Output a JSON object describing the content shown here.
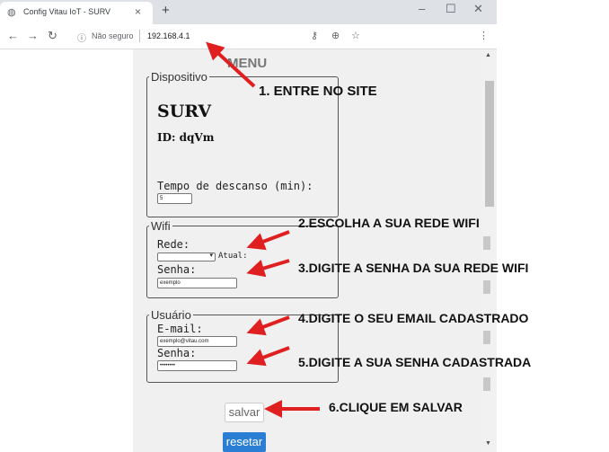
{
  "browser": {
    "tab_title": "Config Vitau IoT - SURV",
    "tab_close": "×",
    "new_tab": "+",
    "security_label": "Não seguro",
    "url": "192.168.4.1"
  },
  "page": {
    "menu_title": "MENU",
    "device": {
      "legend": "Dispositivo",
      "name": "SURV",
      "id": "ID: dqVm",
      "rest_label": "Tempo de descanso (min):",
      "rest_value": "5"
    },
    "wifi": {
      "legend": "Wifi",
      "network_label": "Rede:",
      "current_label": "Atual:",
      "password_label": "Senha:",
      "password_value": "exemplo"
    },
    "user": {
      "legend": "Usuário",
      "email_label": "E-mail:",
      "email_value": "exemplo@vitau.com",
      "password_label": "Senha:",
      "password_value": "••••••••"
    },
    "save_button": "salvar",
    "reset_button": "resetar"
  },
  "annotations": {
    "step1": "1. ENTRE NO SITE",
    "step2": "2.ESCOLHA A SUA REDE WIFI",
    "step3": "3.DIGITE A SENHA DA SUA REDE WIFI",
    "step4": "4.DIGITE O SEU EMAIL CADASTRADO",
    "step5": "5.DIGITE A SUA SENHA CADASTRADA",
    "step6": "6.CLIQUE EM SALVAR"
  },
  "colors": {
    "arrow": "#e02020",
    "reset_button": "#2a7fd4"
  }
}
